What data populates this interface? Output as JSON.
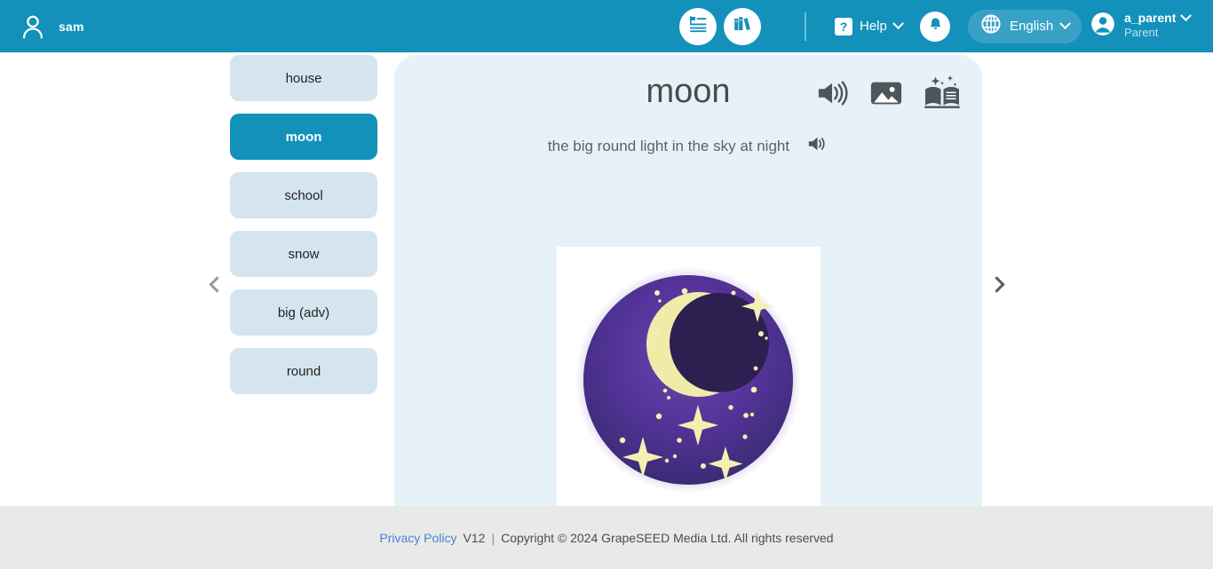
{
  "header": {
    "avatar_icon": "user-icon",
    "username": "sam",
    "nav_icons": [
      {
        "name": "lesson-list-icon",
        "label": "Lesson List"
      },
      {
        "name": "library-books-icon",
        "label": "Library"
      }
    ],
    "help": {
      "badge": "?",
      "label": "Help",
      "caret": "chevron-down-icon"
    },
    "notification_icon": "bell-icon",
    "language": {
      "icon": "globe-icon",
      "label": "English",
      "caret": "chevron-down-icon"
    },
    "account": {
      "icon": "account-circle-icon",
      "name": "a_parent",
      "role": "Parent",
      "caret": "chevron-down-icon"
    },
    "bg_color": "#1391bb"
  },
  "sidebar": {
    "words": [
      {
        "label": "house",
        "active": false
      },
      {
        "label": "moon",
        "active": true
      },
      {
        "label": "school",
        "active": false
      },
      {
        "label": "snow",
        "active": false
      },
      {
        "label": "big (adv)",
        "active": false
      },
      {
        "label": "round",
        "active": false
      }
    ],
    "item_bg": "#d5e5ef",
    "active_bg": "#1391bb"
  },
  "navigation": {
    "prev_icon": "chevron-left-icon",
    "next_icon": "chevron-right-icon"
  },
  "card": {
    "title": "moon",
    "definition": "the big round light in the sky at night",
    "title_audio_icon": "speaker-icon",
    "image_icon": "picture-icon",
    "storybook_icon": "sparkle-book-icon",
    "definition_audio_icon": "speaker-small-icon",
    "panel_bg": "#e6f2f8",
    "illustration": {
      "name": "moon-night-sky-illustration",
      "alt": "crescent moon with stars in a purple night sky circle",
      "sky_color_top": "#5b3b9e",
      "sky_color_bottom": "#3b2c76",
      "moon_color": "#f0eba8",
      "shadow_color": "#2c2050",
      "star_color": "#f5efb0",
      "background": "#ffffff"
    }
  },
  "footer": {
    "privacy_label": "Privacy Policy",
    "version": "V12",
    "separator": "|",
    "copyright": "Copyright © 2024 GrapeSEED Media Ltd. All rights reserved",
    "bg_color": "#e8eae8",
    "link_color": "#4a7fd6"
  }
}
